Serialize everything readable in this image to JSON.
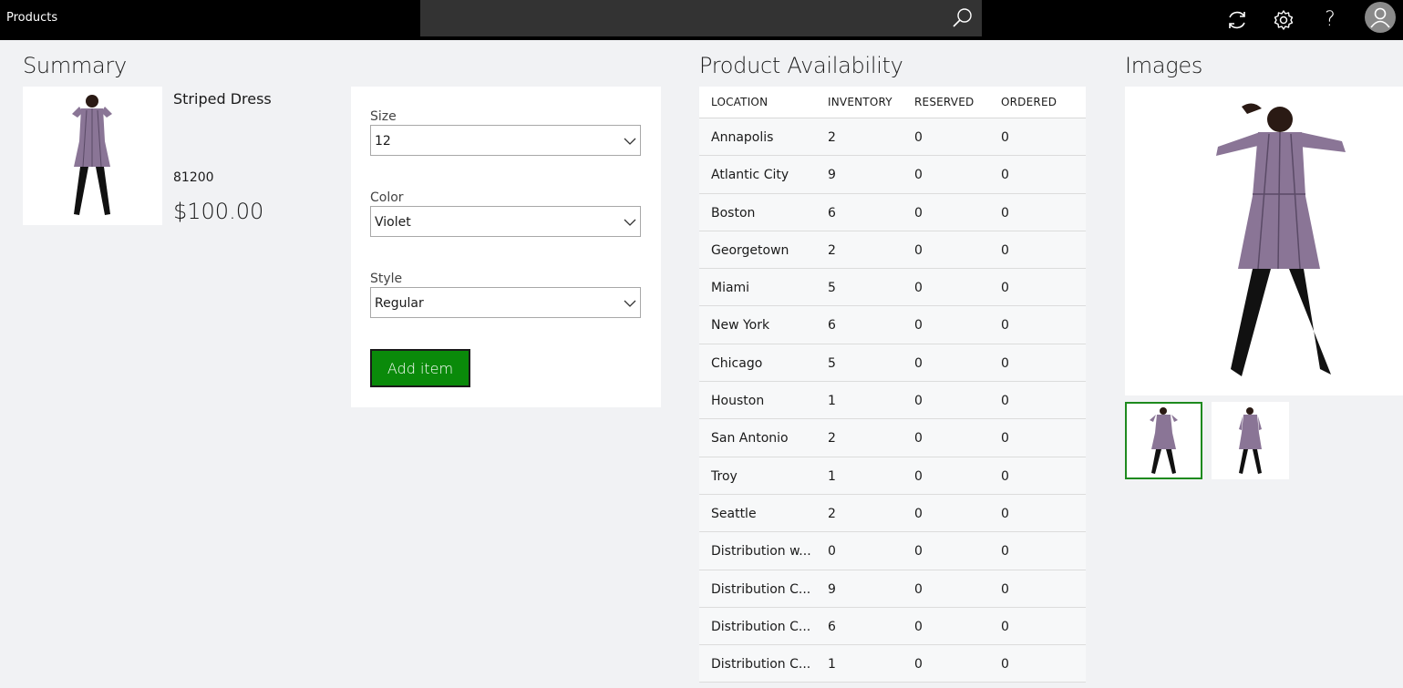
{
  "app": {
    "title": "Products"
  },
  "search": {
    "value": "",
    "placeholder": ""
  },
  "topbar_icons": [
    "search-icon",
    "refresh-icon",
    "gear-icon",
    "help-icon",
    "user-avatar-icon"
  ],
  "help_glyph": "?",
  "summary": {
    "title": "Summary",
    "product_name": "Striped Dress",
    "product_number": "81200",
    "price": "$100.00"
  },
  "variants": {
    "size": {
      "label": "Size",
      "value": "12"
    },
    "color": {
      "label": "Color",
      "value": "Violet"
    },
    "style": {
      "label": "Style",
      "value": "Regular"
    },
    "add_button": "Add item",
    "accent_color": "#0a8a0a"
  },
  "availability": {
    "title": "Product Availability",
    "columns": [
      "LOCATION",
      "INVENTORY",
      "RESERVED",
      "ORDERED"
    ],
    "rows": [
      {
        "location": "Annapolis",
        "inventory": "2",
        "reserved": "0",
        "ordered": "0"
      },
      {
        "location": "Atlantic City",
        "inventory": "9",
        "reserved": "0",
        "ordered": "0"
      },
      {
        "location": "Boston",
        "inventory": "6",
        "reserved": "0",
        "ordered": "0"
      },
      {
        "location": "Georgetown",
        "inventory": "2",
        "reserved": "0",
        "ordered": "0"
      },
      {
        "location": "Miami",
        "inventory": "5",
        "reserved": "0",
        "ordered": "0"
      },
      {
        "location": "New York",
        "inventory": "6",
        "reserved": "0",
        "ordered": "0"
      },
      {
        "location": "Chicago",
        "inventory": "5",
        "reserved": "0",
        "ordered": "0"
      },
      {
        "location": "Houston",
        "inventory": "1",
        "reserved": "0",
        "ordered": "0"
      },
      {
        "location": "San Antonio",
        "inventory": "2",
        "reserved": "0",
        "ordered": "0"
      },
      {
        "location": "Troy",
        "inventory": "1",
        "reserved": "0",
        "ordered": "0"
      },
      {
        "location": "Seattle",
        "inventory": "2",
        "reserved": "0",
        "ordered": "0"
      },
      {
        "location": "Distribution w...",
        "inventory": "0",
        "reserved": "0",
        "ordered": "0"
      },
      {
        "location": "Distribution C...",
        "inventory": "9",
        "reserved": "0",
        "ordered": "0"
      },
      {
        "location": "Distribution C...",
        "inventory": "6",
        "reserved": "0",
        "ordered": "0"
      },
      {
        "location": "Distribution C...",
        "inventory": "1",
        "reserved": "0",
        "ordered": "0"
      }
    ]
  },
  "images": {
    "title": "Images",
    "thumbnails": 2,
    "selected_thumbnail": 0,
    "selection_color": "#1e8a1e",
    "dress_color": "#8a7596"
  }
}
